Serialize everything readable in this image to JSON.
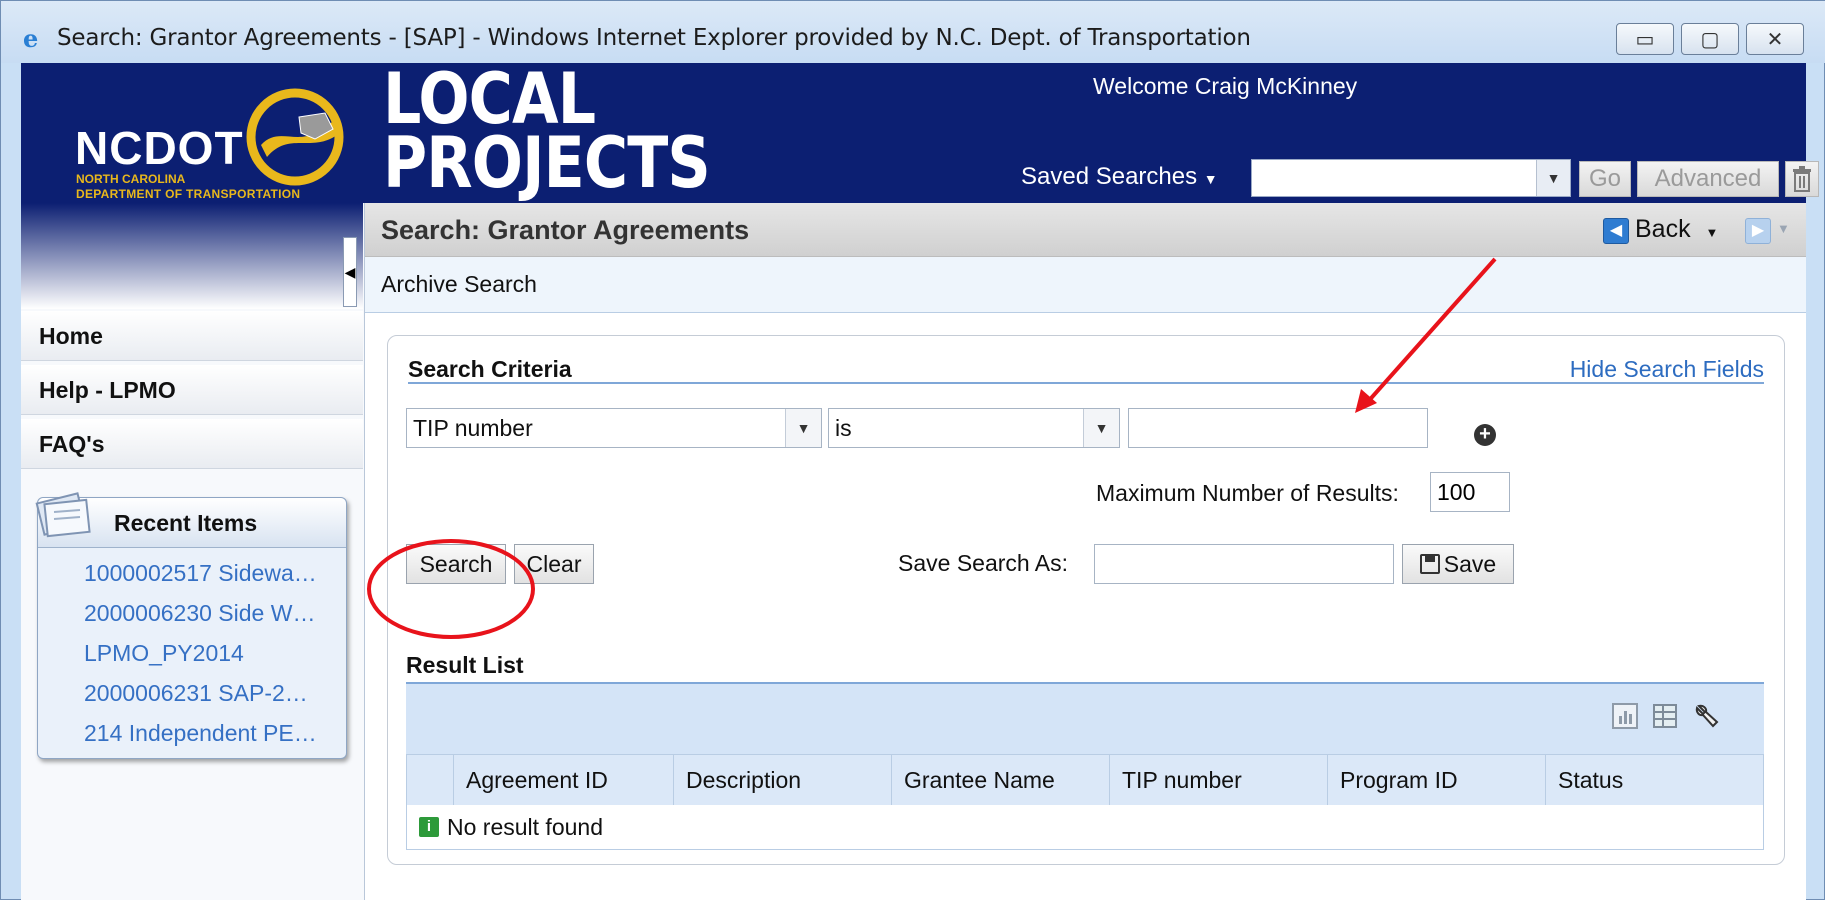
{
  "window": {
    "title": "Search: Grantor Agreements - [SAP] - Windows Internet Explorer provided by N.C. Dept. of Transportation",
    "minimize": "▭",
    "maximize": "▢",
    "close": "✕"
  },
  "header": {
    "logo_text": "NCDOT",
    "logo_sub1": "NORTH CAROLINA",
    "logo_sub2": "DEPARTMENT OF TRANSPORTATION",
    "app_title_line1": "LOCAL",
    "app_title_line2": "PROJECTS",
    "welcome": "Welcome Craig McKinney",
    "saved_searches_label": "Saved Searches",
    "saved_searches_value": "",
    "go_label": "Go",
    "advanced_label": "Advanced",
    "trash_icon": "trash-icon"
  },
  "sidebar": {
    "nav": [
      {
        "label": "Home"
      },
      {
        "label": "Help - LPMO"
      },
      {
        "label": "FAQ's"
      }
    ],
    "recent_title": "Recent Items",
    "recent_items": [
      "1000002517 Sidewa…",
      "2000006230 Side W…",
      "LPMO_PY2014",
      "2000006231 SAP-2…",
      "214 Independent PE…"
    ]
  },
  "page": {
    "title": "Search: Grantor Agreements",
    "back_label": "Back",
    "subtitle": "Archive Search"
  },
  "criteria": {
    "title": "Search Criteria",
    "hide_link": "Hide Search Fields",
    "field_value": "TIP number",
    "operator_value": "is",
    "input_value": "",
    "max_label": "Maximum Number of Results:",
    "max_value": "100",
    "search_button": "Search",
    "clear_button": "Clear",
    "save_as_label": "Save Search As:",
    "save_as_value": "",
    "save_button": "Save"
  },
  "results": {
    "title": "Result List",
    "columns": [
      "Agreement ID",
      "Description",
      "Grantee Name",
      "TIP number",
      "Program ID",
      "Status"
    ],
    "empty_text": "No result found"
  },
  "colors": {
    "header_bg": "#0c1f72",
    "link": "#2d6cc0",
    "annotation": "#e8131b"
  }
}
